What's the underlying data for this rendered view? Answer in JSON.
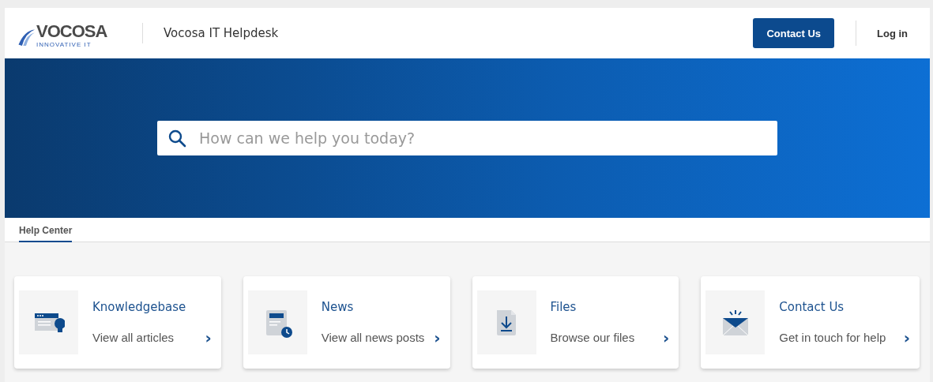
{
  "header": {
    "logo": {
      "text": "VOCOSA",
      "tagline": "INNOVATIVE IT"
    },
    "site_title": "Vocosa IT Helpdesk",
    "contact_button": "Contact Us",
    "login_link": "Log in"
  },
  "search": {
    "placeholder": "How can we help you today?"
  },
  "tabs": [
    {
      "label": "Help Center",
      "selected": true
    }
  ],
  "cards": [
    {
      "kind": "knowledgebase",
      "title": "Knowledgebase",
      "link": "View all articles",
      "chevron": "›"
    },
    {
      "kind": "news",
      "title": "News",
      "link": "View all news posts",
      "chevron": "›"
    },
    {
      "kind": "files",
      "title": "Files",
      "link": "Browse our files",
      "chevron": "›"
    },
    {
      "kind": "contact",
      "title": "Contact Us",
      "link": "Get in touch for help",
      "chevron": "›"
    }
  ]
}
